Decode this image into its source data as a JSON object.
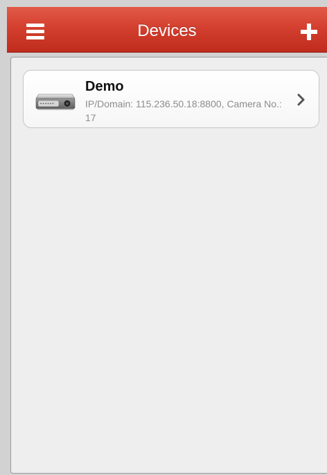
{
  "header": {
    "title": "Devices",
    "menu_icon": "hamburger-menu-icon",
    "add_icon": "plus-icon",
    "accent_color": "#d4402f"
  },
  "devices": [
    {
      "name": "Demo",
      "info": "IP/Domain: 115.236.50.18:8800, Camera No.: 17",
      "icon": "dvr-device-icon",
      "action_icon": "chevron-right-icon"
    }
  ]
}
